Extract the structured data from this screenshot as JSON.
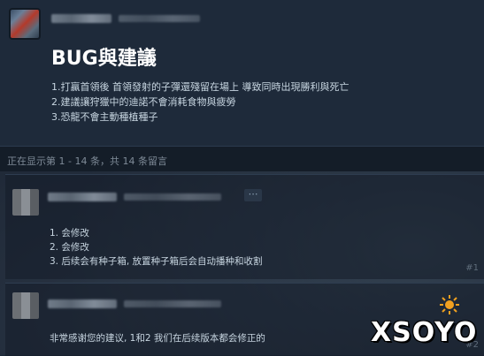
{
  "post": {
    "title": "BUG與建議",
    "lines": [
      "1.打贏首領後 首領發射的子彈還殘留在場上 導致同時出現勝利與死亡",
      "2.建議讓狩獵中的迪諾不會消耗食物與疲勞",
      "3.恐龍不會主動種植種子"
    ]
  },
  "comments_count": "正在显示第 1 - 14 条，共 14 条留言",
  "comments": [
    {
      "lines": [
        "1. 会修改",
        "2. 会修改",
        "3. 后续会有种子箱, 放置种子箱后会自动播种和收割"
      ],
      "number": "#1",
      "more_icon": "ellipsis-icon"
    },
    {
      "lines": [
        "非常感谢您的建议, 1和2 我们在后续版本都会修正的"
      ],
      "number": "#2"
    }
  ],
  "watermark": {
    "text": "XSOYO",
    "sun_color": "#f0a020"
  }
}
